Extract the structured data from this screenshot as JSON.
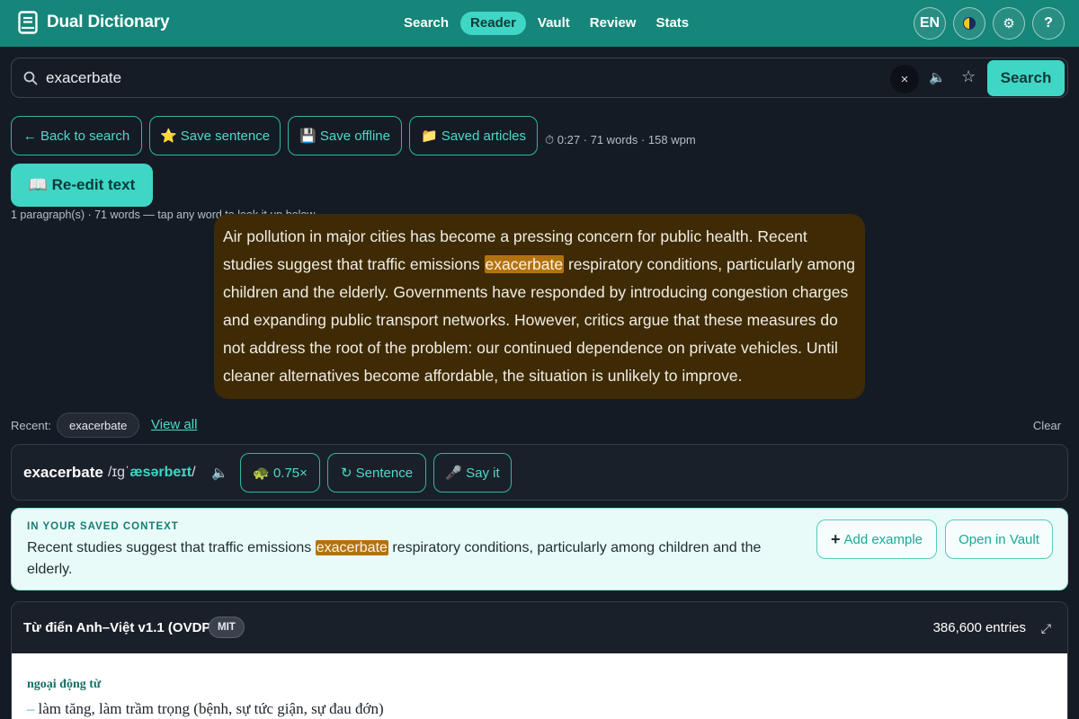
{
  "header": {
    "app_name": "Dual Dictionary",
    "nav": [
      {
        "label": "Search",
        "active": false
      },
      {
        "label": "Reader",
        "active": true
      },
      {
        "label": "Vault",
        "active": false
      },
      {
        "label": "Review",
        "active": false
      },
      {
        "label": "Stats",
        "active": false
      }
    ],
    "lang_button": "EN",
    "settings_icon": "⚙",
    "help_button": "?"
  },
  "search": {
    "query": "exacerbate",
    "clear_label": "×",
    "button_label": "Search"
  },
  "toolbar": {
    "back_label": "← Back to search",
    "save_sentence_label": "⭐ Save sentence",
    "save_offline_label": "💾 Save offline",
    "saved_articles_label": "📁 Saved articles",
    "reading_meta": "⏱ 0:27 · 71 words · 158 wpm",
    "reedit_label": "📖 Re-edit text",
    "paragraph_meta": "1 paragraph(s) · 71 words — tap any word to look it up below."
  },
  "passage": {
    "before": "Air pollution in major cities has become a pressing concern for public health. Recent studies suggest that traffic emissions ",
    "highlight": "exacerbate",
    "after": " respiratory conditions, particularly among children and the elderly. Governments have responded by introducing congestion charges and expanding public transport networks. However, critics argue that these measures do not address the root of the problem: our continued dependence on private vehicles. Until cleaner alternatives become affordable, the situation is unlikely to improve."
  },
  "recent": {
    "label": "Recent:",
    "items": [
      "exacerbate"
    ],
    "view_all": "View all",
    "clear": "Clear"
  },
  "word": {
    "headword": "exacerbate",
    "ipa_prefix": "/ɪɡˈ",
    "ipa_stress": "æsərbeɪt",
    "ipa_suffix": "/",
    "speed_label": "🐢 0.75×",
    "sentence_label": "↻ Sentence",
    "say_it_label": "🎤 Say it"
  },
  "saved_context": {
    "label": "IN YOUR SAVED CONTEXT",
    "before": "Recent studies suggest that traffic emissions ",
    "highlight": "exacerbate",
    "after": " respiratory conditions, particularly among children and the elderly.",
    "add_example_label": "Add example",
    "open_vault_label": "Open in Vault"
  },
  "dictionary": {
    "title": "Từ điển Anh–Việt v1.1 (OVDP)",
    "license": "MIT",
    "entries": "386,600 entries",
    "part_of_speech": "ngoại động từ",
    "sense": "làm tăng, làm trầm trọng (bệnh, sự tức giận, sự đau đớn)"
  },
  "colors": {
    "header_bg": "#16857a",
    "accent": "#3fd6c6",
    "highlight": "#b37210",
    "passage_bg": "#3e2b05"
  }
}
